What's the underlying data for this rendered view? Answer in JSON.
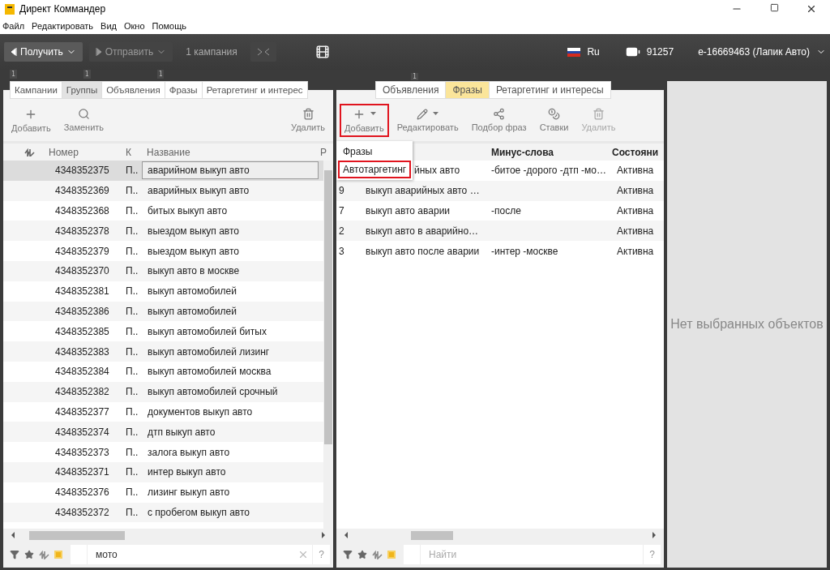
{
  "window": {
    "title": "Директ Коммандер"
  },
  "menu": [
    "Файл",
    "Редактировать",
    "Вид",
    "Окно",
    "Помощь"
  ],
  "toolbar": {
    "get_button": "Получить",
    "send_button": "Отправить",
    "campaign_count": "1 кампания",
    "language": "Ru",
    "balance": "91257",
    "account": "e-16669463 (Лапик Авто)"
  },
  "left_panel": {
    "badges": [
      "1",
      "1",
      "1"
    ],
    "tabs": [
      {
        "label": "Кампании",
        "selected": false
      },
      {
        "label": "Группы",
        "selected": true
      },
      {
        "label": "Объявления",
        "selected": false
      },
      {
        "label": "Фразы",
        "selected": false
      },
      {
        "label": "Ретаргетинг и интерес",
        "selected": false
      }
    ],
    "actions": [
      {
        "kind": "add",
        "label": "Добавить"
      },
      {
        "kind": "search",
        "label": "Заменить"
      },
      {
        "kind": "delete",
        "label": "Удалить"
      }
    ],
    "columns": [
      "Номер",
      "К",
      "Название",
      "Р"
    ],
    "rows": [
      {
        "number": "4348352375",
        "k": "П..",
        "name": "аварийном выкуп авто",
        "selected": true
      },
      {
        "number": "4348352369",
        "k": "П..",
        "name": "аварийных выкуп авто",
        "selected": false
      },
      {
        "number": "4348352368",
        "k": "П..",
        "name": "битых выкуп авто",
        "selected": false
      },
      {
        "number": "4348352378",
        "k": "П..",
        "name": "выездом выкуп авто",
        "selected": false
      },
      {
        "number": "4348352379",
        "k": "П..",
        "name": "выездом выкуп авто",
        "selected": false
      },
      {
        "number": "4348352370",
        "k": "П..",
        "name": "выкуп авто в москве",
        "selected": false
      },
      {
        "number": "4348352381",
        "k": "П..",
        "name": "выкуп автомобилей",
        "selected": false
      },
      {
        "number": "4348352386",
        "k": "П..",
        "name": "выкуп автомобилей",
        "selected": false
      },
      {
        "number": "4348352385",
        "k": "П..",
        "name": "выкуп автомобилей битых",
        "selected": false
      },
      {
        "number": "4348352383",
        "k": "П..",
        "name": "выкуп автомобилей лизинг",
        "selected": false
      },
      {
        "number": "4348352384",
        "k": "П..",
        "name": "выкуп автомобилей москва",
        "selected": false
      },
      {
        "number": "4348352382",
        "k": "П..",
        "name": "выкуп автомобилей срочный",
        "selected": false
      },
      {
        "number": "4348352377",
        "k": "П..",
        "name": "документов выкуп авто",
        "selected": false
      },
      {
        "number": "4348352374",
        "k": "П..",
        "name": "дтп выкуп авто",
        "selected": false
      },
      {
        "number": "4348352373",
        "k": "П..",
        "name": "залога выкуп авто",
        "selected": false
      },
      {
        "number": "4348352371",
        "k": "П..",
        "name": "интер выкуп авто",
        "selected": false
      },
      {
        "number": "4348352376",
        "k": "П..",
        "name": "лизинг выкуп авто",
        "selected": false
      },
      {
        "number": "4348352372",
        "k": "П..",
        "name": "с пробегом выкуп авто",
        "selected": false
      }
    ],
    "search": {
      "value": "мото",
      "help": "?"
    }
  },
  "middle_panel": {
    "badge": "1",
    "tabs": [
      {
        "label": "Объявления",
        "selected": false
      },
      {
        "label": "Фразы",
        "selected": true
      },
      {
        "label": "Ретаргетинг и интересы",
        "selected": false
      }
    ],
    "actions": [
      {
        "kind": "add",
        "label": "Добавить",
        "dropdown": true,
        "disabled": false,
        "highlighted": true
      },
      {
        "kind": "edit",
        "label": "Редактировать",
        "dropdown": true,
        "disabled": false,
        "highlighted": false
      },
      {
        "kind": "pick",
        "label": "Подбор фраз",
        "dropdown": false,
        "disabled": false,
        "highlighted": false
      },
      {
        "kind": "bids",
        "label": "Ставки",
        "dropdown": false,
        "disabled": false,
        "highlighted": false
      },
      {
        "kind": "delete",
        "label": "Удалить",
        "dropdown": false,
        "disabled": true,
        "highlighted": false
      }
    ],
    "columns": [
      "Минус-слова",
      "Состояни"
    ],
    "rows": [
      {
        "phrase": "йных авто",
        "minus": "-битое -дорого -дтп -мо…",
        "state": "Активна",
        "covered": true
      },
      {
        "number": "9",
        "phrase": "выкуп аварийных авто …",
        "state": "Активна",
        "covered": false
      },
      {
        "number": "7",
        "phrase": "выкуп авто аварии",
        "minus": "-после",
        "state": "Активна",
        "covered": false
      },
      {
        "number": "2",
        "phrase": "выкуп авто в аварийно…",
        "state": "Активна",
        "covered": false
      },
      {
        "number": "3",
        "phrase": "выкуп авто после аварии",
        "minus": "-интер -москве",
        "state": "Активна",
        "covered": false
      }
    ],
    "add_menu": [
      {
        "label": "Фразы",
        "highlighted": false
      },
      {
        "label": "Автотаргетинг",
        "highlighted": true
      }
    ],
    "search": {
      "placeholder": "Найти",
      "help": "?"
    }
  },
  "right_panel": {
    "empty_text": "Нет выбранных объектов"
  }
}
